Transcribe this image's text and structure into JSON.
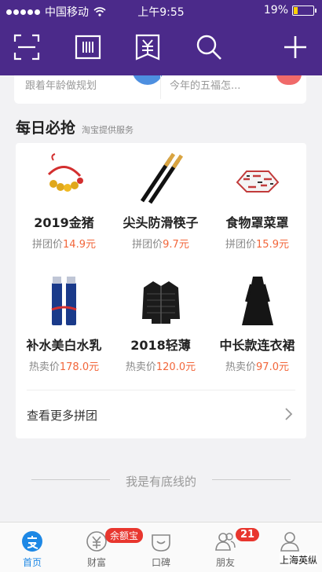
{
  "status_bar": {
    "carrier": "中国移动",
    "time": "上午9:55",
    "battery": "19%",
    "battery_level": 0.19
  },
  "header": {
    "icons": [
      "scan-icon",
      "barcode-icon",
      "payment-icon",
      "search-icon",
      "add-icon"
    ]
  },
  "top_strip": {
    "left_text": "跟着年龄做规划",
    "right_text": "今年的五福怎..."
  },
  "daily": {
    "title": "每日必抢",
    "subtitle": "淘宝提供服务",
    "products": [
      {
        "name": "2019金猪",
        "price_label": "拼团价",
        "price": "14.9元",
        "icon": "bracelet-icon"
      },
      {
        "name": "尖头防滑筷子",
        "price_label": "拼团价",
        "price": "9.7元",
        "icon": "chopsticks-icon"
      },
      {
        "name": "食物罩菜罩",
        "price_label": "拼团价",
        "price": "15.9元",
        "icon": "food-cover-icon"
      },
      {
        "name": "补水美白水乳",
        "price_label": "热卖价",
        "price": "178.0元",
        "icon": "lotion-bottles-icon"
      },
      {
        "name": "2018轻薄",
        "price_label": "热卖价",
        "price": "120.0元",
        "icon": "down-jacket-icon"
      },
      {
        "name": "中长款连衣裙",
        "price_label": "热卖价",
        "price": "97.0元",
        "icon": "dress-icon"
      }
    ],
    "more_label": "查看更多拼团"
  },
  "footer_text": "我是有底线的",
  "tabbar": {
    "tabs": [
      {
        "label": "首页",
        "icon": "home-alipay-icon",
        "active": true
      },
      {
        "label": "财富",
        "icon": "wealth-icon",
        "active": false
      },
      {
        "label": "口碑",
        "icon": "koubei-icon",
        "active": false
      },
      {
        "label": "朋友",
        "icon": "friends-icon",
        "active": false
      },
      {
        "label": "我的",
        "icon": "profile-icon",
        "active": false
      }
    ],
    "wealth_badge": "余额宝",
    "friends_badge": "21"
  },
  "watermark": "上海英纵",
  "colors": {
    "header": "#4b2a8a",
    "accent": "#1e88e5",
    "price": "#f2663a",
    "badge": "#e8362e"
  }
}
